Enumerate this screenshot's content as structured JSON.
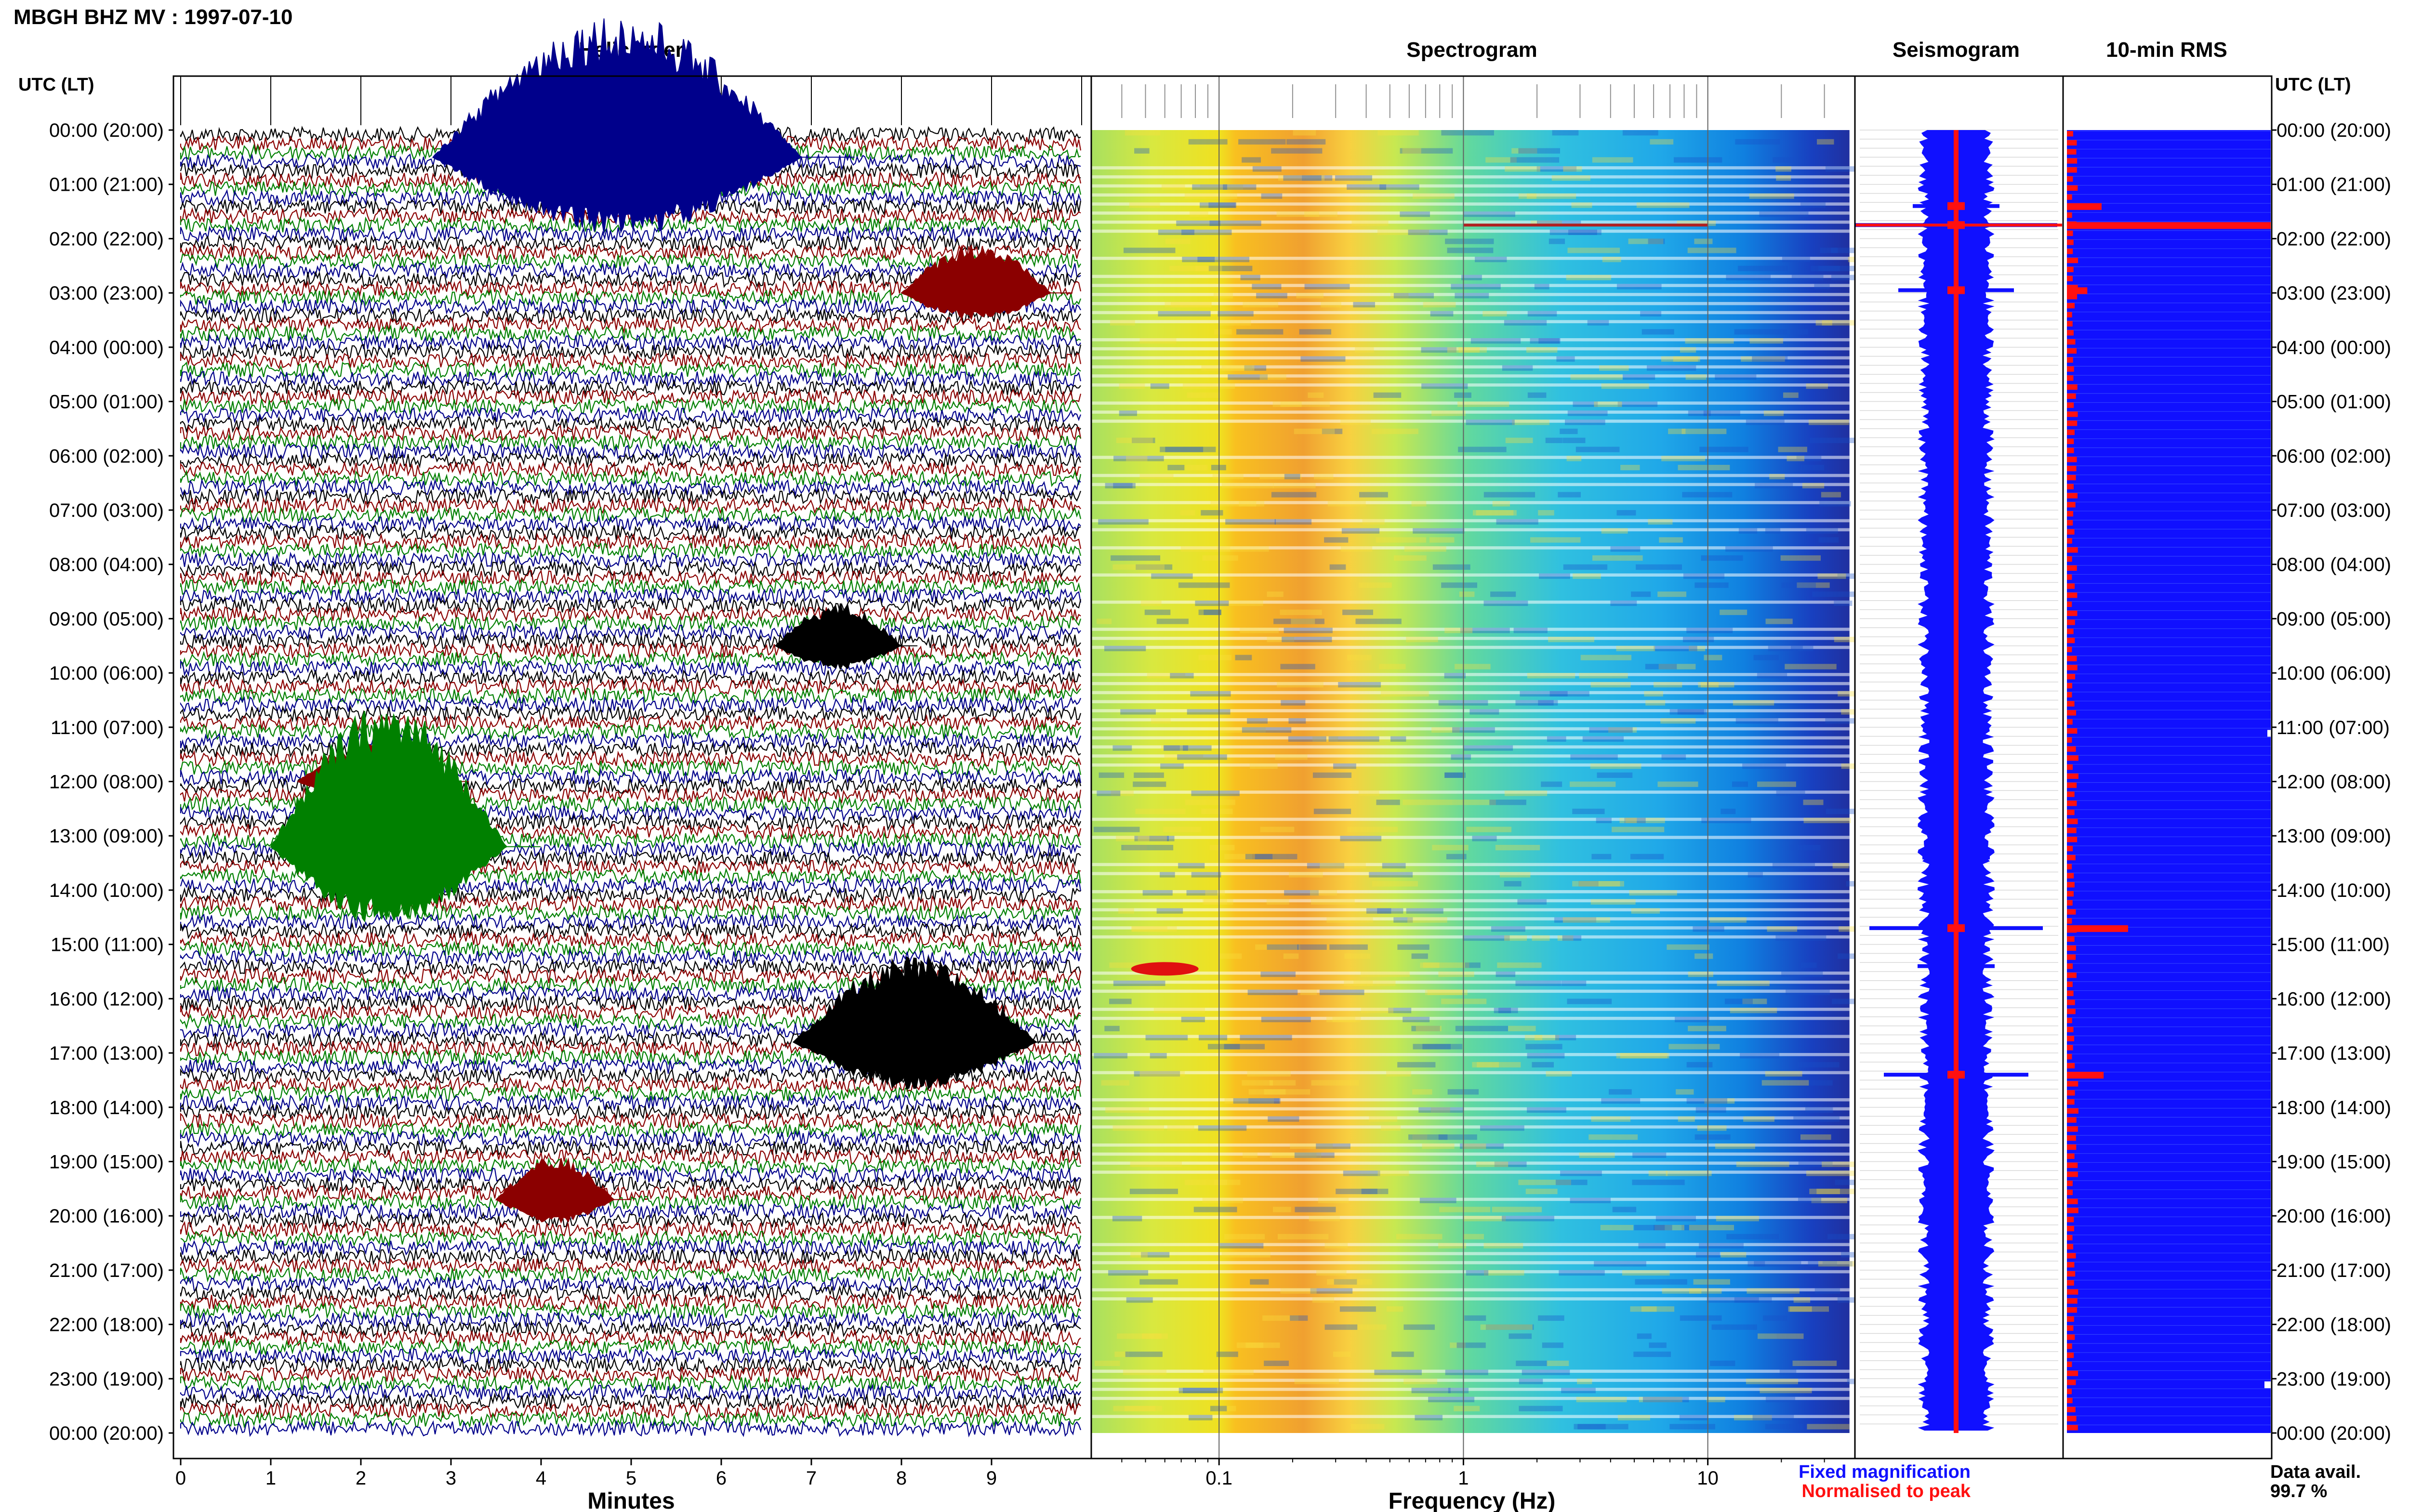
{
  "chart_data": {
    "type": "table",
    "title": "MBGH BHZ MV : 1997-07-10",
    "row_axis_label": "UTC (LT)",
    "row_labels": [
      "00:00 (20:00)",
      "01:00 (21:00)",
      "02:00 (22:00)",
      "03:00 (23:00)",
      "04:00 (00:00)",
      "05:00 (01:00)",
      "06:00 (02:00)",
      "07:00 (03:00)",
      "08:00 (04:00)",
      "09:00 (05:00)",
      "10:00 (06:00)",
      "11:00 (07:00)",
      "12:00 (08:00)",
      "13:00 (09:00)",
      "14:00 (10:00)",
      "15:00 (11:00)",
      "16:00 (12:00)",
      "17:00 (13:00)",
      "18:00 (14:00)",
      "19:00 (15:00)",
      "20:00 (16:00)",
      "21:00 (17:00)",
      "22:00 (18:00)",
      "23:00 (19:00)",
      "00:00 (20:00)"
    ],
    "panels": {
      "helicorder": {
        "title": "Helicorder",
        "xlabel": "Minutes",
        "xlim": [
          0,
          10
        ],
        "ticks": [
          "0",
          "1",
          "2",
          "3",
          "4",
          "5",
          "6",
          "7",
          "8",
          "9"
        ],
        "trace_colors": [
          "#000000",
          "#8b0000",
          "#008000",
          "#00008b"
        ],
        "events": [
          {
            "hour": 0.5,
            "start_min": 2.8,
            "end_min": 7.5,
            "amplitude": 1.0,
            "color": "#00008b"
          },
          {
            "hour": 3.0,
            "start_min": 8.0,
            "end_min": 9.9,
            "amplitude": 0.35,
            "color": "#8b0000"
          },
          {
            "hour": 9.5,
            "start_min": 6.6,
            "end_min": 8.2,
            "amplitude": 0.3,
            "color": "#000000"
          },
          {
            "hour": 12.0,
            "start_min": 1.3,
            "end_min": 3.2,
            "amplitude": 0.3,
            "color": "#8b0000"
          },
          {
            "hour": 13.2,
            "start_min": 1.0,
            "end_min": 4.0,
            "amplitude": 1.0,
            "color": "#008000"
          },
          {
            "hour": 16.8,
            "start_min": 6.8,
            "end_min": 9.9,
            "amplitude": 0.6,
            "color": "#000000"
          },
          {
            "hour": 19.7,
            "start_min": 3.5,
            "end_min": 5.0,
            "amplitude": 0.3,
            "color": "#8b0000"
          }
        ]
      },
      "spectrogram": {
        "title": "Spectrogram",
        "xlabel": "Frequency (Hz)",
        "scale": "log",
        "xlim": [
          0.03,
          40
        ],
        "ticks": [
          "0.1",
          "1",
          "10"
        ]
      },
      "seismogram": {
        "title": "Seismogram",
        "legend": [
          {
            "label": "Fixed magnification",
            "color": "#1010ff"
          },
          {
            "label": "Normalised to peak",
            "color": "#ff1010"
          }
        ]
      },
      "rms": {
        "title": "10-min RMS",
        "footer_label": "Data avail.",
        "footer_value": "99.7 %",
        "peaks": [
          {
            "hour": 1.75,
            "value": 1.0
          },
          {
            "hour": 1.4,
            "value": 0.17
          },
          {
            "hour": 2.95,
            "value": 0.1
          },
          {
            "hour": 14.7,
            "value": 0.3
          },
          {
            "hour": 17.4,
            "value": 0.18
          }
        ]
      }
    }
  }
}
